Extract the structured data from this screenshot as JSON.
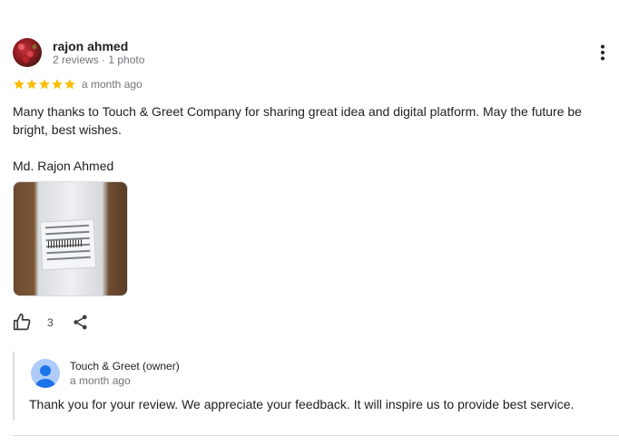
{
  "review": {
    "author": "rajon ahmed",
    "author_meta": "2 reviews · 1 photo",
    "rating": 5,
    "time": "a month ago",
    "text": "Many thanks to Touch & Greet Company for sharing great idea and digital platform. May the future be bright, best wishes.",
    "signature": "Md. Rajon Ahmed",
    "like_count": "3"
  },
  "reply": {
    "owner_name": "Touch & Greet (owner)",
    "time": "a month ago",
    "text": "Thank you for your review. We appreciate your feedback. It will inspire us to provide best service."
  },
  "colors": {
    "star": "#fbbc04",
    "icon": "#3c4043",
    "owner_avatar": "#aecbfa",
    "owner_avatar_figure": "#1a73e8"
  },
  "icons": {
    "more": "more-vert-icon",
    "like": "thumb-up-icon",
    "share": "share-icon",
    "star": "star-icon"
  }
}
